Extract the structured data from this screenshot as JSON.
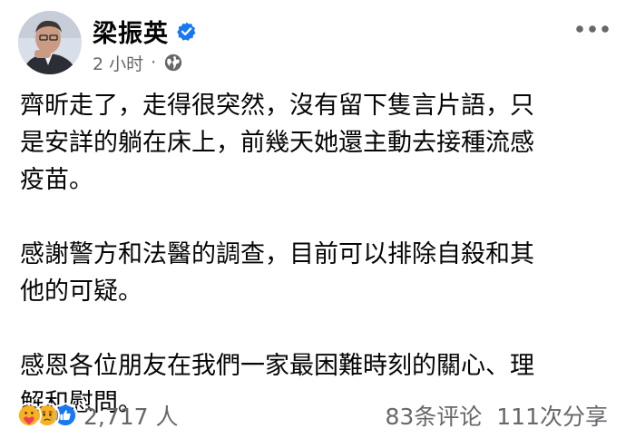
{
  "post": {
    "author": "梁振英",
    "time": "2 小时",
    "separator": "·",
    "paragraphs": [
      "齊昕走了，走得很突然，沒有留下隻言片語，只\n是安詳的躺在床上，前幾天她還主動去接種流感\n疫苗。",
      "感謝警方和法醫的調查，目前可以排除自殺和其\n他的可疑。",
      "感恩各位朋友在我們一家最困難時刻的關心、理\n解和慰問。"
    ]
  },
  "footer": {
    "reaction_icons": [
      "care-icon",
      "sad-icon",
      "like-icon"
    ],
    "reaction_count": "2,717 人",
    "comments": "83条评论",
    "shares": "111次分享"
  },
  "colors": {
    "text": "#050505",
    "secondary_text": "#65676b",
    "verified_blue": "#1877f2",
    "reaction_yellow": "#f7b125"
  }
}
